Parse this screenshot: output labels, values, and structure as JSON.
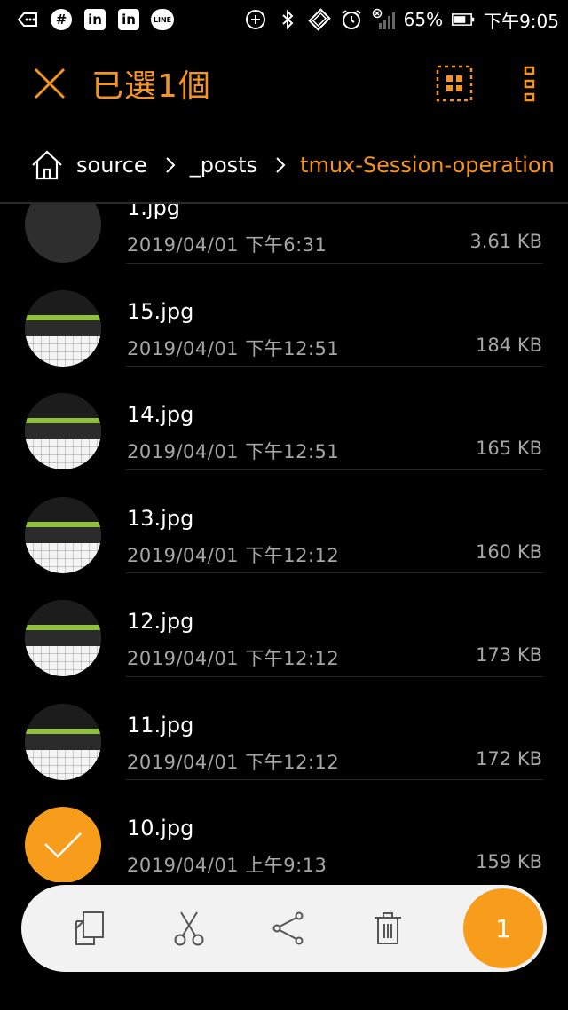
{
  "status_bar": {
    "app_icon_1": "#",
    "app_icon_2": "in",
    "app_icon_3": "in",
    "app_icon_4": "LINE",
    "battery_percent": "65%",
    "time": "下午9:05"
  },
  "action_bar": {
    "title": "已選1個",
    "accent_color": "#f5941e"
  },
  "breadcrumb": {
    "items": [
      "source",
      "_posts",
      "tmux-Session-operation"
    ]
  },
  "files": [
    {
      "name": "1.jpg",
      "date": "2019/04/01 下午6:31",
      "size": "3.61 KB",
      "selected": false
    },
    {
      "name": "15.jpg",
      "date": "2019/04/01 下午12:51",
      "size": "184 KB",
      "selected": false
    },
    {
      "name": "14.jpg",
      "date": "2019/04/01 下午12:51",
      "size": "165 KB",
      "selected": false
    },
    {
      "name": "13.jpg",
      "date": "2019/04/01 下午12:12",
      "size": "160 KB",
      "selected": false
    },
    {
      "name": "12.jpg",
      "date": "2019/04/01 下午12:12",
      "size": "173 KB",
      "selected": false
    },
    {
      "name": "11.jpg",
      "date": "2019/04/01 下午12:12",
      "size": "172 KB",
      "selected": false
    },
    {
      "name": "10.jpg",
      "date": "2019/04/01 上午9:13",
      "size": "159 KB",
      "selected": true
    }
  ],
  "toolbar": {
    "actions": [
      "copy-icon",
      "cut-icon",
      "share-icon",
      "delete-icon"
    ],
    "selected_count": "1"
  }
}
